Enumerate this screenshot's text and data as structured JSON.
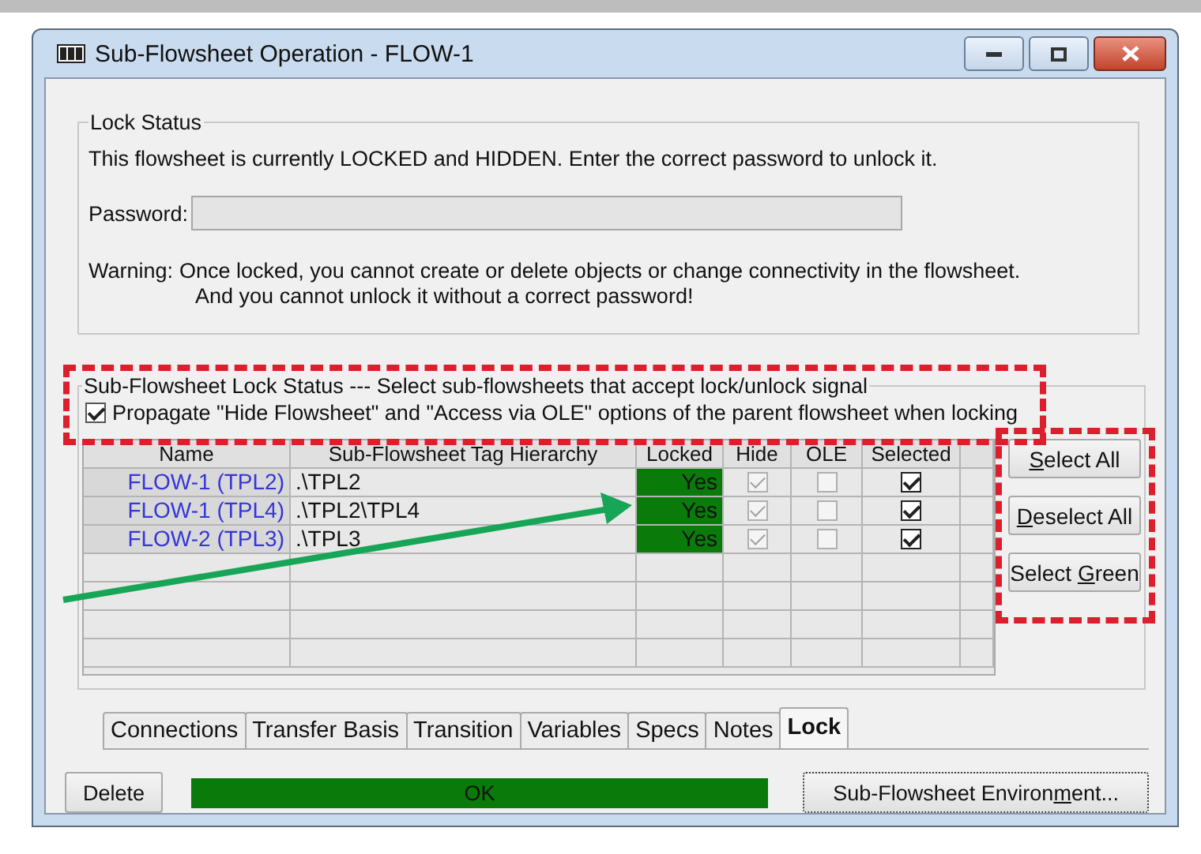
{
  "window": {
    "title": "Sub-Flowsheet Operation - FLOW-1"
  },
  "lock_status": {
    "title": "Lock Status",
    "message": "This flowsheet is currently LOCKED and HIDDEN. Enter the correct password to unlock it.",
    "password_label": "Password:",
    "warning_label": "Warning:",
    "warning_lines": [
      "Once locked, you cannot create or delete objects or change connectivity in the flowsheet.",
      "And you cannot unlock it without a correct password!"
    ]
  },
  "sub_lock": {
    "title": "Sub-Flowsheet Lock Status --- Select sub-flowsheets that accept lock/unlock signal",
    "propagate": {
      "label": "Propagate \"Hide Flowsheet\" and \"Access via OLE\" options of the parent flowsheet when locking",
      "checked": true
    },
    "columns": [
      "Name",
      "Sub-Flowsheet Tag Hierarchy",
      "Locked",
      "Hide",
      "OLE",
      "Selected"
    ],
    "rows": [
      {
        "name": "FLOW-1 (TPL2)",
        "hierarchy": ".\\TPL2",
        "locked": "Yes",
        "hide": true,
        "ole": false,
        "selected": true
      },
      {
        "name": "FLOW-1 (TPL4)",
        "hierarchy": ".\\TPL2\\TPL4",
        "locked": "Yes",
        "hide": true,
        "ole": false,
        "selected": true
      },
      {
        "name": "FLOW-2 (TPL3)",
        "hierarchy": ".\\TPL3",
        "locked": "Yes",
        "hide": true,
        "ole": false,
        "selected": true
      }
    ],
    "buttons": [
      {
        "label": "Select All"
      },
      {
        "label": "Deselect All"
      },
      {
        "label": "Select Green"
      }
    ]
  },
  "tabs": [
    {
      "label": "Connections",
      "selected": false
    },
    {
      "label": "Transfer Basis",
      "selected": false
    },
    {
      "label": "Transition",
      "selected": false
    },
    {
      "label": "Variables",
      "selected": false
    },
    {
      "label": "Specs",
      "selected": false
    },
    {
      "label": "Notes",
      "selected": false
    },
    {
      "label": "Lock",
      "selected": true
    }
  ],
  "footer": {
    "delete": "Delete",
    "status": {
      "text": "OK",
      "level": 1
    },
    "environment": {
      "label": "Sub-Flowsheet Environment..."
    }
  }
}
